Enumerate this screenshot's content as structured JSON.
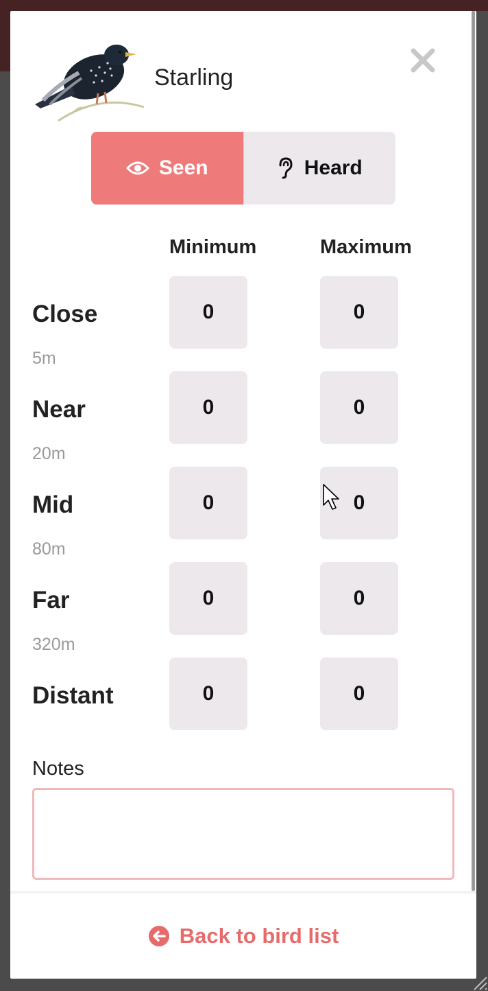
{
  "bird": {
    "name": "Starling",
    "image_icon": "starling-illustration"
  },
  "close_icon": "close-x-icon",
  "toggle": {
    "seen_label": "Seen",
    "heard_label": "Heard",
    "selected": "Seen",
    "seen_color": "#ef7a7a"
  },
  "table": {
    "min_header": "Minimum",
    "max_header": "Maximum",
    "rows": [
      {
        "label": "Close",
        "distance": "5m",
        "min": "0",
        "max": "0"
      },
      {
        "label": "Near",
        "distance": "20m",
        "min": "0",
        "max": "0"
      },
      {
        "label": "Mid",
        "distance": "80m",
        "min": "0",
        "max": "0"
      },
      {
        "label": "Far",
        "distance": "320m",
        "min": "0",
        "max": "0"
      },
      {
        "label": "Distant",
        "distance": "",
        "min": "0",
        "max": "0"
      }
    ]
  },
  "notes": {
    "label": "Notes",
    "value": ""
  },
  "footer": {
    "back_label": "Back to bird list",
    "accent_color": "#e66b6b"
  }
}
